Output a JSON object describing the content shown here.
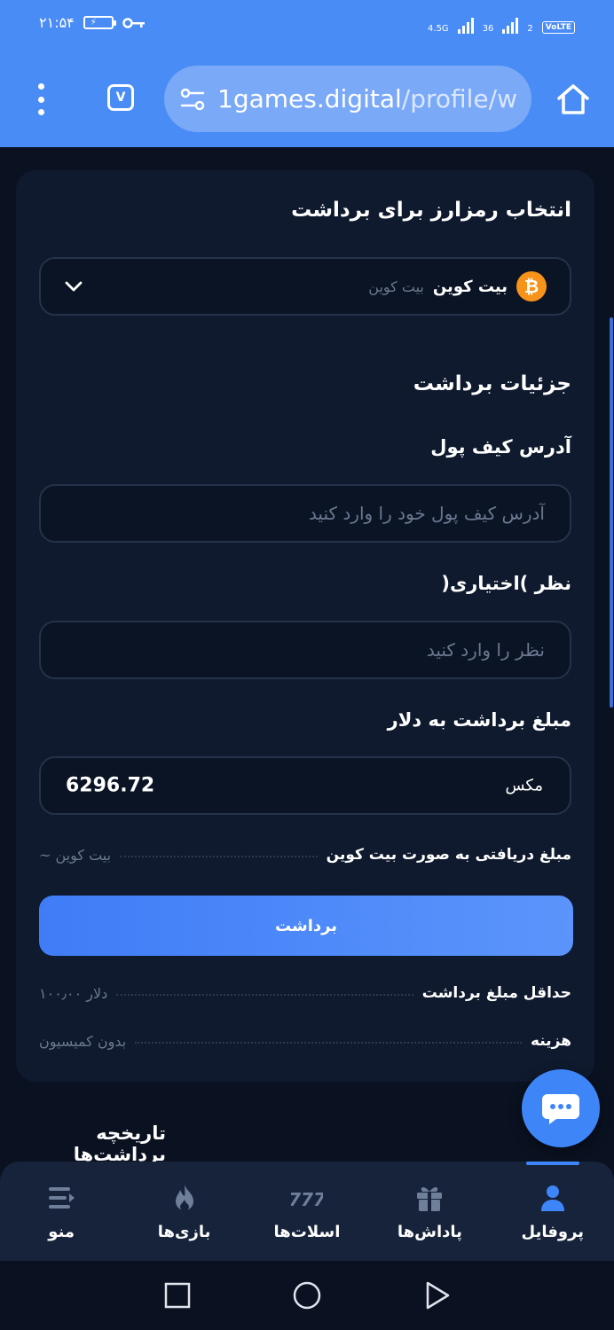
{
  "status_bar": {
    "time": "۲۱:۵۴",
    "net_left": "4.5G",
    "net_right": "36",
    "sim": "2",
    "volte": "VoLTE"
  },
  "browser": {
    "tab_count": "V",
    "url_host": "1games.digital",
    "url_path": "/profile/w"
  },
  "crypto_select": {
    "title": "انتخاب رمزارز برای برداشت",
    "selected_label": "بیت کوین",
    "selected_sub": "بیت کوین"
  },
  "details": {
    "title": "جزئیات برداشت",
    "wallet_label": "آدرس کیف پول",
    "wallet_placeholder": "آدرس کیف پول خود را وارد کنید",
    "comment_label": "نظر )اختیاری(",
    "comment_placeholder": "نظر را وارد کنید",
    "amount_label": "مبلغ برداشت به دلار",
    "amount_value": "6296.72",
    "max_label": "مکس",
    "receive_label": "مبلغ دریافتی به صورت بیت کوین",
    "receive_value": "بیت کوین ~"
  },
  "withdraw_button": "برداشت",
  "min_row": {
    "label": "حداقل مبلغ برداشت",
    "value": "دلار ۱۰۰٫۰۰"
  },
  "fee_row": {
    "label": "هزینه",
    "value": "بدون کمیسیون"
  },
  "history_title": "تاریخچه برداشت‌ها",
  "bottom_nav": {
    "profile": "پروفایل",
    "rewards": "پاداش‌ها",
    "slots": "اسلات‌ها",
    "games": "بازی‌ها",
    "menu": "منو"
  },
  "colors": {
    "accent": "#3e86f7",
    "browser_bar": "#4a8cf6",
    "background": "#0a1120",
    "card": "#0f1a2e",
    "bitcoin": "#f7931a"
  }
}
